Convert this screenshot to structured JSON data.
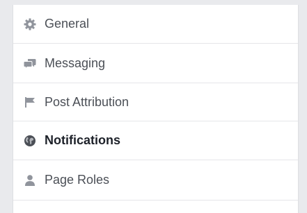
{
  "nav": {
    "items": [
      {
        "label": "General",
        "icon": "gear-icon",
        "active": false
      },
      {
        "label": "Messaging",
        "icon": "chat-bubbles-icon",
        "active": false
      },
      {
        "label": "Post Attribution",
        "icon": "flag-icon",
        "active": false
      },
      {
        "label": "Notifications",
        "icon": "globe-icon",
        "active": true
      },
      {
        "label": "Page Roles",
        "icon": "person-icon",
        "active": false
      }
    ]
  },
  "colors": {
    "background": "#e9eaed",
    "panel": "#ffffff",
    "divider": "#e5e6e9",
    "label": "#4b4f56",
    "label_active": "#1d2129",
    "icon": "#90949c",
    "icon_active": "#4b4f56"
  }
}
